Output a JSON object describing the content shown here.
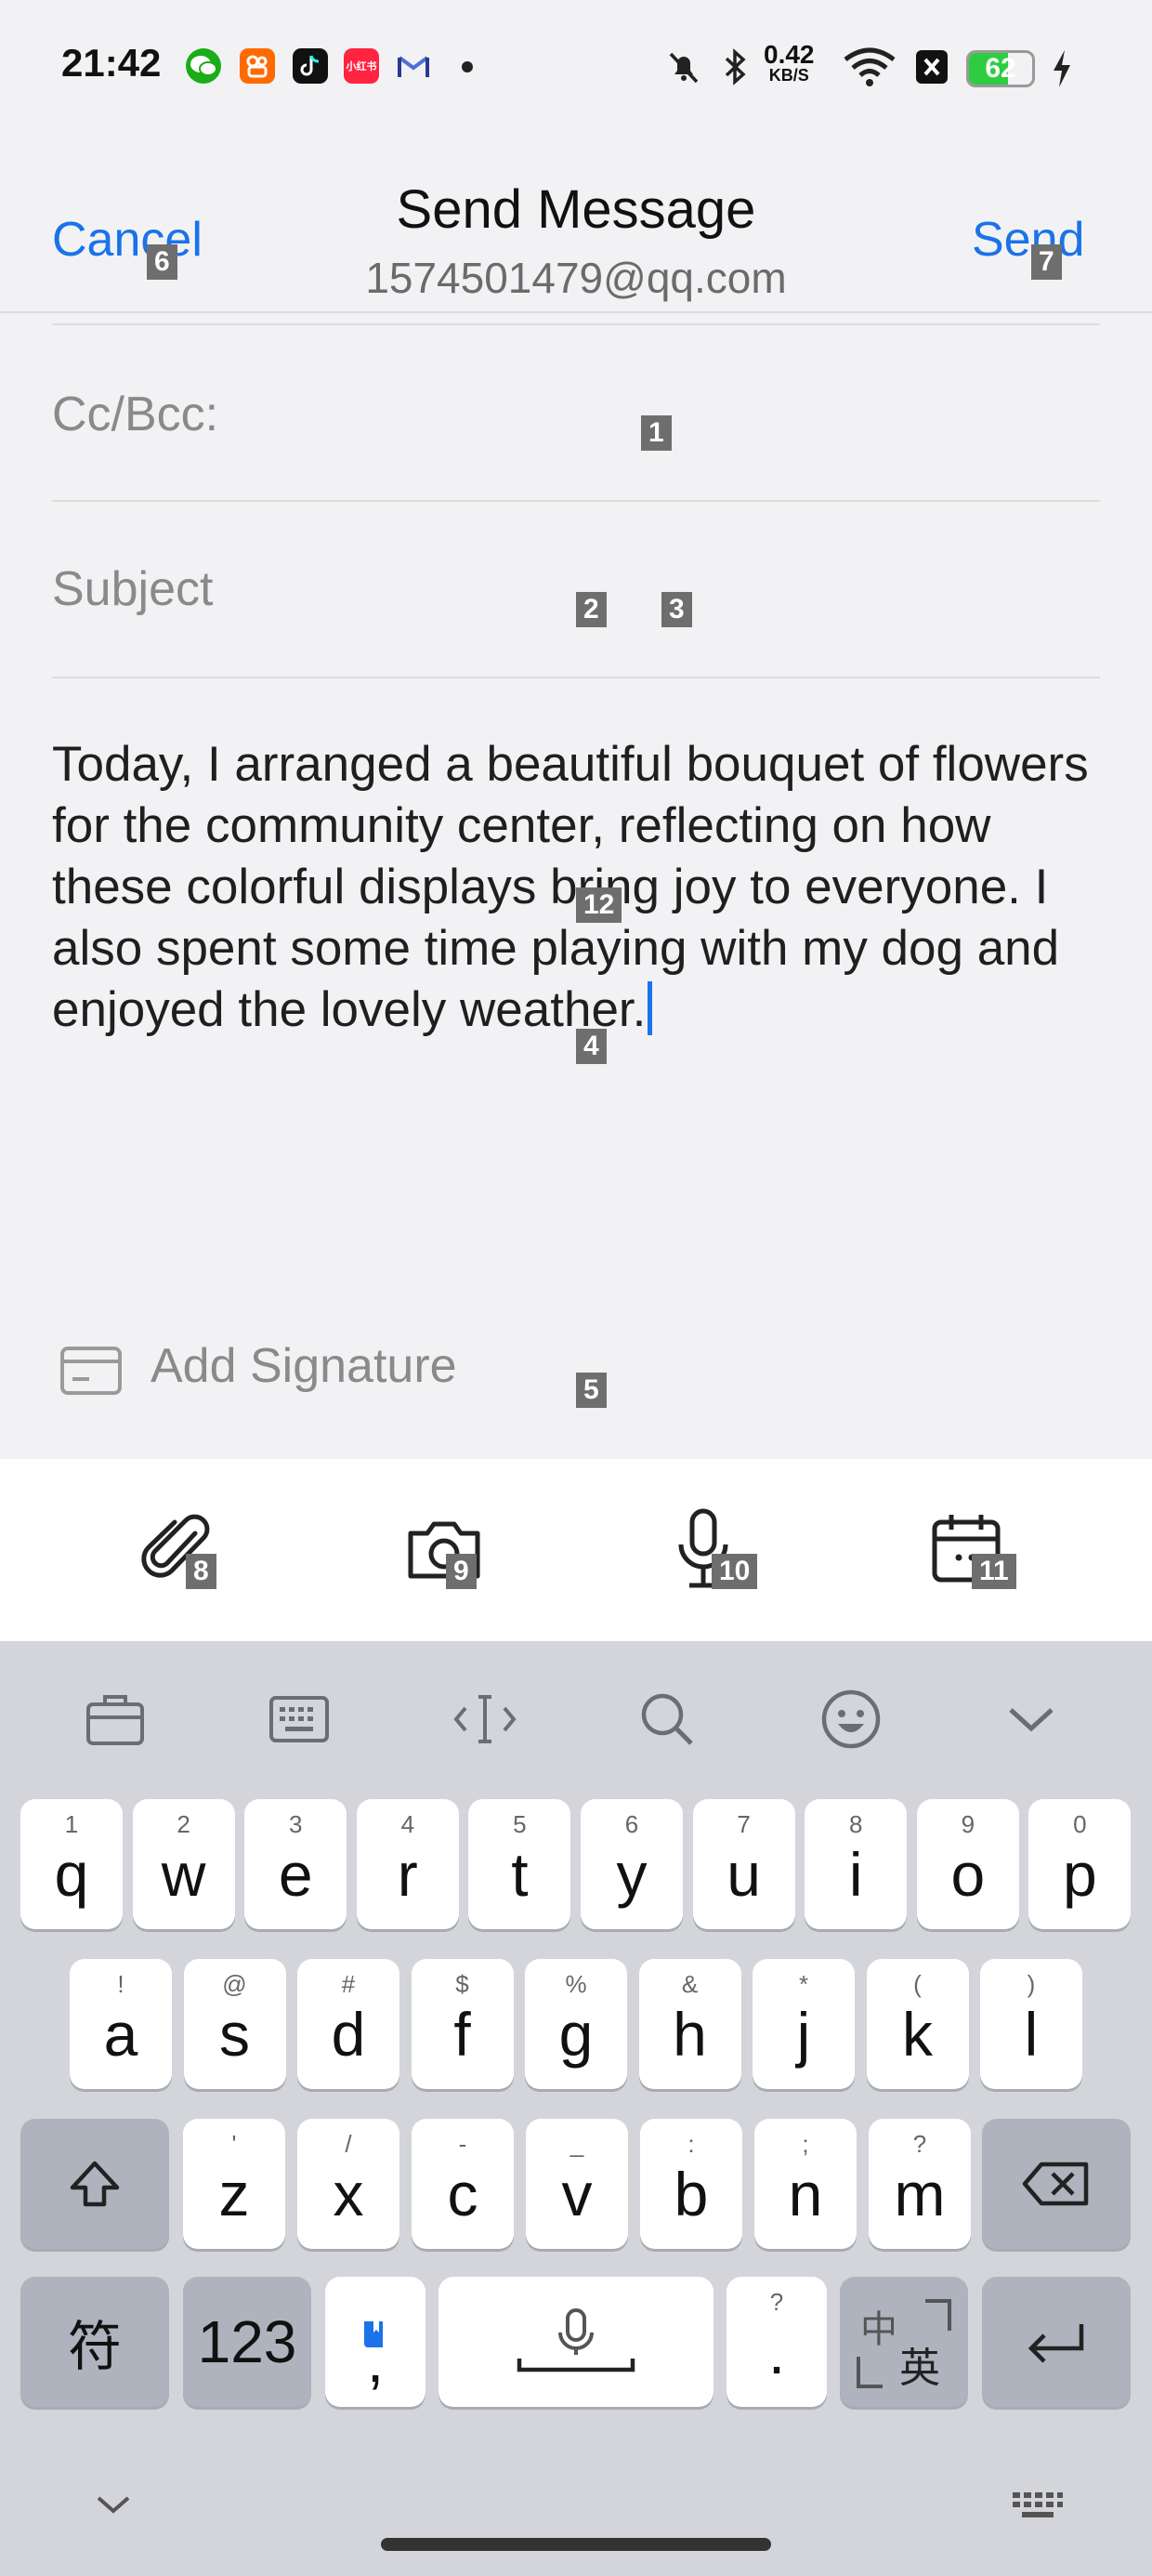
{
  "status_bar": {
    "time": "21:42",
    "notif_apps": [
      "wechat-icon",
      "kuaishou-icon",
      "tiktok-icon",
      "xiaohongshu-icon",
      "gmail-icon"
    ],
    "xiaohongshu_label": "小红书",
    "net_speed_value": "0.42",
    "net_speed_unit": "KB/S",
    "battery_level": "62",
    "battery_fraction": 0.62,
    "battery_color": "#2ecc40"
  },
  "header": {
    "cancel": "Cancel",
    "title": "Send Message",
    "account": "1574501479@qq.com",
    "send": "Send",
    "accent_color": "#1a73e8"
  },
  "form": {
    "cc_bcc_label": "Cc/Bcc:",
    "subject_placeholder": "Subject",
    "body": "Today, I arranged a beautiful bouquet of flowers for the community center, reflecting on how these colorful displays bring joy to everyone. I also spent some time playing with my dog and enjoyed the lovely weather.",
    "signature_label": "Add Signature"
  },
  "toolbar": {
    "items": [
      "attachment-icon",
      "camera-icon",
      "microphone-icon",
      "calendar-icon"
    ]
  },
  "keyboard": {
    "tools": [
      "clipboard-icon",
      "keyboard-layout-icon",
      "cursor-icon",
      "search-icon",
      "emoji-icon",
      "collapse-icon"
    ],
    "row1": [
      {
        "hint": "1",
        "key": "q"
      },
      {
        "hint": "2",
        "key": "w"
      },
      {
        "hint": "3",
        "key": "e"
      },
      {
        "hint": "4",
        "key": "r"
      },
      {
        "hint": "5",
        "key": "t"
      },
      {
        "hint": "6",
        "key": "y"
      },
      {
        "hint": "7",
        "key": "u"
      },
      {
        "hint": "8",
        "key": "i"
      },
      {
        "hint": "9",
        "key": "o"
      },
      {
        "hint": "0",
        "key": "p"
      }
    ],
    "row2": [
      {
        "hint": "!",
        "key": "a"
      },
      {
        "hint": "@",
        "key": "s"
      },
      {
        "hint": "#",
        "key": "d"
      },
      {
        "hint": "$",
        "key": "f"
      },
      {
        "hint": "%",
        "key": "g"
      },
      {
        "hint": "&",
        "key": "h"
      },
      {
        "hint": "*",
        "key": "j"
      },
      {
        "hint": "(",
        "key": "k"
      },
      {
        "hint": ")",
        "key": "l"
      }
    ],
    "row3": [
      {
        "hint": "'",
        "key": "z"
      },
      {
        "hint": "/",
        "key": "x"
      },
      {
        "hint": "-",
        "key": "c"
      },
      {
        "hint": "_",
        "key": "v"
      },
      {
        "hint": ":",
        "key": "b"
      },
      {
        "hint": ";",
        "key": "n"
      },
      {
        "hint": "?",
        "key": "m"
      }
    ],
    "symbols_key": "符",
    "numbers_key": "123",
    "comma_key": ",",
    "period_hint": "?",
    "period_key": ".",
    "lang_key_top": "中",
    "lang_key_bottom": "英"
  },
  "annotation_badges": [
    "1",
    "2",
    "3",
    "4",
    "5",
    "6",
    "7",
    "8",
    "9",
    "10",
    "11",
    "12"
  ]
}
